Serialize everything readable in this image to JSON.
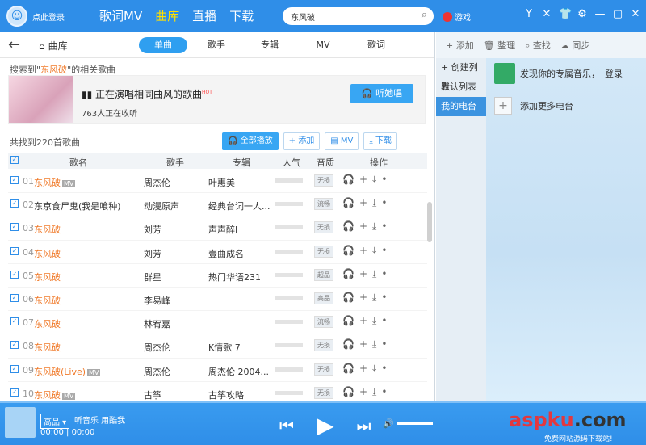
{
  "topbar": {
    "login": "点此登录",
    "nav": [
      "歌词MV",
      "曲库",
      "直播",
      "下载"
    ],
    "active_nav": "曲库",
    "search_value": "东风破",
    "games": "游戏"
  },
  "subnav": {
    "home": "曲库",
    "tabs": [
      "单曲",
      "歌手",
      "专辑",
      "MV",
      "歌词"
    ]
  },
  "search_result": {
    "prefix": "搜索到\"",
    "keyword": "东风破",
    "suffix": "\"的相关歌曲"
  },
  "banner": {
    "title": "正在演唱相同曲风的歌曲",
    "hot": "HOT",
    "count": "763人正在收听",
    "listen_btn": "听她唱"
  },
  "list": {
    "total": "共找到220首歌曲",
    "actions": [
      "全部播放",
      "添加",
      "MV",
      "下载"
    ],
    "headers": [
      "歌名",
      "歌手",
      "专辑",
      "人气",
      "音质",
      "操作"
    ],
    "rows": [
      {
        "num": "01",
        "song": "东风破",
        "mv": "MV",
        "artist": "周杰伦",
        "album": "叶惠美",
        "quality": "无损",
        "orange": true
      },
      {
        "num": "02",
        "song": "东京食尸鬼(我是喰种)",
        "mv": "",
        "artist": "动漫原声",
        "album": "经典台词一人...",
        "quality": "流畅",
        "orange": false
      },
      {
        "num": "03",
        "song": "东风破",
        "mv": "",
        "artist": "刘芳",
        "album": "声声醉Ⅰ",
        "quality": "无损",
        "orange": true
      },
      {
        "num": "04",
        "song": "东风破",
        "mv": "",
        "artist": "刘芳",
        "album": "壹曲成名",
        "quality": "无损",
        "orange": true
      },
      {
        "num": "05",
        "song": "东风破",
        "mv": "",
        "artist": "群星",
        "album": "热门华语231",
        "quality": "超品",
        "orange": true
      },
      {
        "num": "06",
        "song": "东风破",
        "mv": "",
        "artist": "李易峰",
        "album": "",
        "quality": "高品",
        "orange": true
      },
      {
        "num": "07",
        "song": "东风破",
        "mv": "",
        "artist": "林宥嘉",
        "album": "",
        "quality": "流畅",
        "orange": true
      },
      {
        "num": "08",
        "song": "东风破",
        "mv": "",
        "artist": "周杰伦",
        "album": "K情歌 7",
        "quality": "无损",
        "orange": true
      },
      {
        "num": "09",
        "song": "东风破(Live)",
        "mv": "MV",
        "artist": "周杰伦",
        "album": "周杰伦 2004...",
        "quality": "无损",
        "orange": true
      },
      {
        "num": "10",
        "song": "东风破",
        "mv": "MV",
        "artist": "古筝",
        "album": "古筝攻略",
        "quality": "无损",
        "orange": true
      }
    ]
  },
  "right": {
    "tools": [
      "添加",
      "整理",
      "查找",
      "同步"
    ],
    "menu": [
      "创建列表",
      "默认列表",
      "我的电台"
    ],
    "discover": "发现你的专属音乐，",
    "login": "登录",
    "add_more": "添加更多电台"
  },
  "player": {
    "quality": "高品",
    "now_playing": "听音乐 用酷我",
    "time_current": "00:00",
    "time_total": "00:00"
  },
  "watermark": {
    "brand": "aspku",
    "suffix": ".com",
    "sub": "免费网站源码下载站!"
  }
}
